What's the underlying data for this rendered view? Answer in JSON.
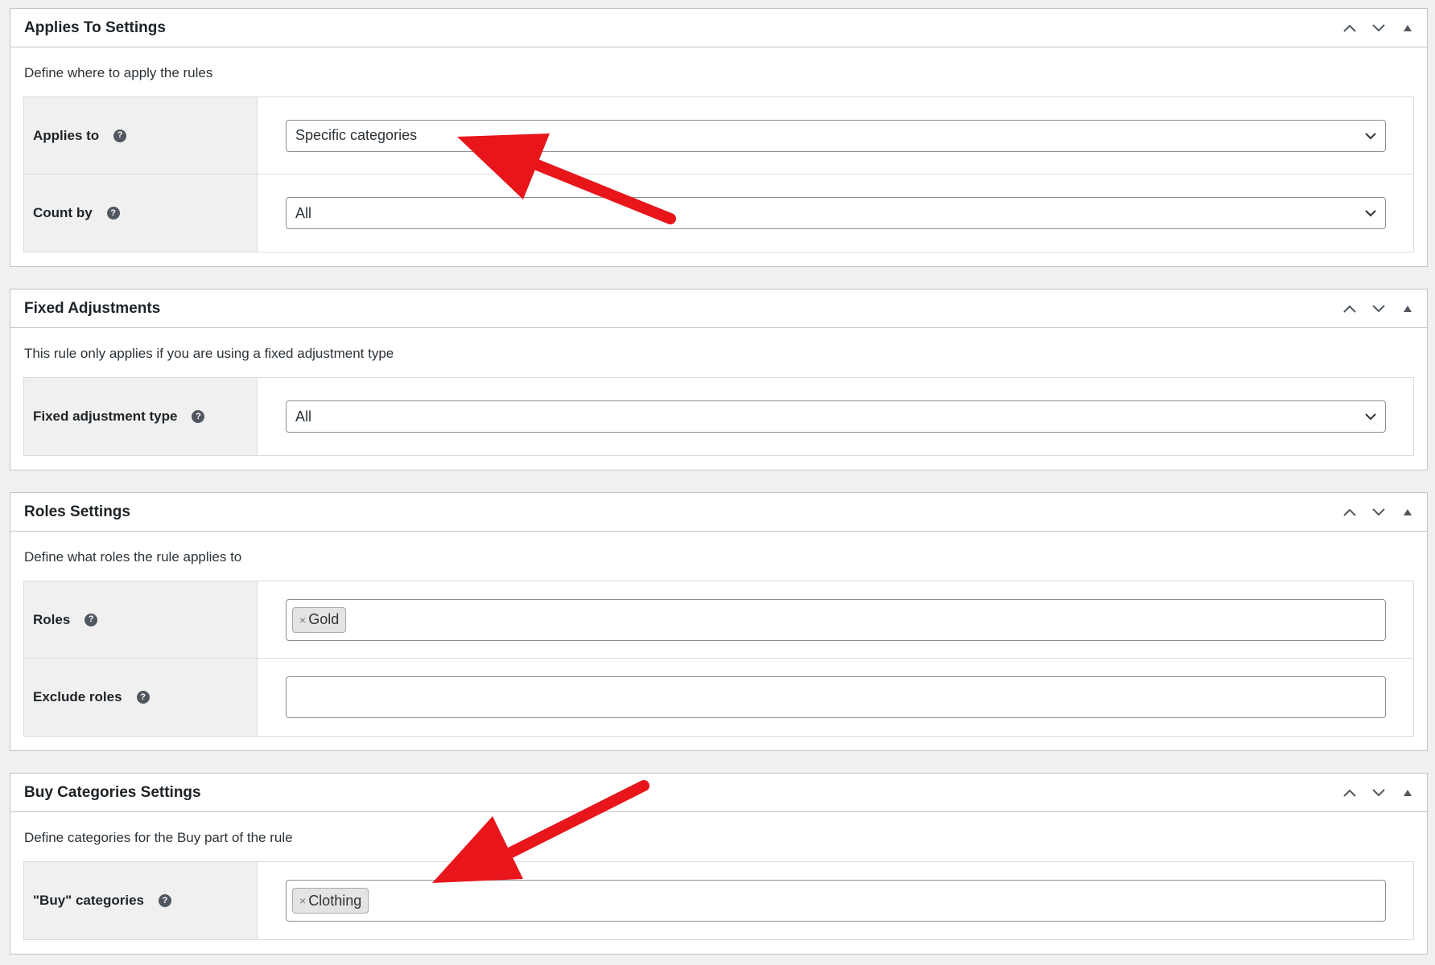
{
  "panels": [
    {
      "title": "Applies To Settings",
      "description": "Define where to apply the rules",
      "fields": [
        {
          "label": "Applies to",
          "value": "Specific categories"
        },
        {
          "label": "Count by",
          "value": "All"
        }
      ]
    },
    {
      "title": "Fixed Adjustments",
      "description": "This rule only applies if you are using a fixed adjustment type",
      "fields": [
        {
          "label": "Fixed adjustment type",
          "value": "All"
        }
      ]
    },
    {
      "title": "Roles Settings",
      "description": "Define what roles the rule applies to",
      "fields": [
        {
          "label": "Roles",
          "tokens": [
            "Gold"
          ]
        },
        {
          "label": "Exclude roles",
          "tokens": []
        }
      ]
    },
    {
      "title": "Buy Categories Settings",
      "description": "Define categories for the Buy part of the rule",
      "fields": [
        {
          "label": "\"Buy\" categories",
          "tokens": [
            "Clothing"
          ]
        }
      ]
    }
  ],
  "icons": {
    "help": "question-circle-icon",
    "move_up": "chevron-up-icon",
    "move_down": "chevron-down-icon",
    "toggle": "triangle-up-icon",
    "remove_token": "×",
    "help_glyph": "?"
  },
  "colors": {
    "annotation_arrow": "#e8151b",
    "page_background": "#f0f0f1",
    "label_cell_background": "#f0f0f1",
    "border": "#c3c4c7"
  }
}
